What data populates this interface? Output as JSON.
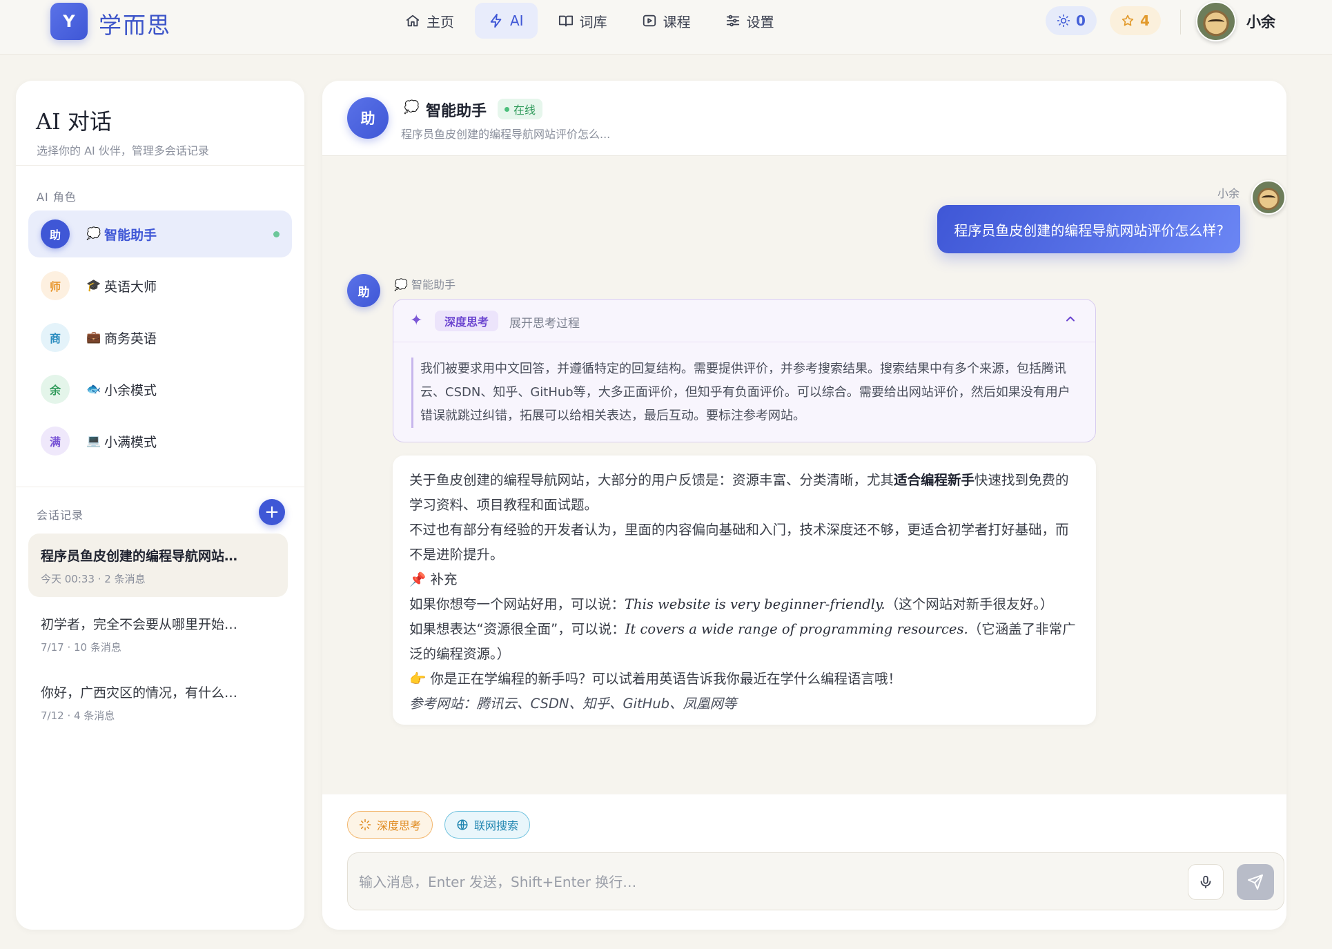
{
  "brand": {
    "logo_letter": "Y",
    "name": "学而思"
  },
  "nav": [
    {
      "label": "主页",
      "icon": "home-icon",
      "active": false
    },
    {
      "label": "AI",
      "icon": "bolt-icon",
      "active": true
    },
    {
      "label": "词库",
      "icon": "book-icon",
      "active": false
    },
    {
      "label": "课程",
      "icon": "play-icon",
      "active": false
    },
    {
      "label": "设置",
      "icon": "sliders-icon",
      "active": false
    }
  ],
  "stats": {
    "sun_count": "0",
    "star_count": "4"
  },
  "user": {
    "name": "小余"
  },
  "sidebar": {
    "title": "AI 对话",
    "subtitle": "选择你的 AI 伙伴，管理多会话记录",
    "roles_label": "AI 角色",
    "roles": [
      {
        "badge": "助",
        "emoji": "💭",
        "name": "智能助手",
        "active": true
      },
      {
        "badge": "师",
        "emoji": "🎓",
        "name": "英语大师",
        "active": false
      },
      {
        "badge": "商",
        "emoji": "💼",
        "name": "商务英语",
        "active": false
      },
      {
        "badge": "余",
        "emoji": "🐟",
        "name": "小余模式",
        "active": false
      },
      {
        "badge": "满",
        "emoji": "💻",
        "name": "小满模式",
        "active": false
      }
    ],
    "sessions_label": "会话记录",
    "add_label": "+",
    "sessions": [
      {
        "title": "程序员鱼皮创建的编程导航网站…",
        "meta": "今天 00:33 · 2 条消息",
        "active": true
      },
      {
        "title": "初学者，完全不会要从哪里开始…",
        "meta": "7/17 · 10 条消息",
        "active": false
      },
      {
        "title": "你好，广西灾区的情况，有什么…",
        "meta": "7/12 · 4 条消息",
        "active": false
      }
    ]
  },
  "chat": {
    "header": {
      "avatar": "助",
      "emoji": "💭",
      "title": "智能助手",
      "status": "在线",
      "subtitle": "程序员鱼皮创建的编程导航网站评价怎么..."
    },
    "user_message": {
      "sender": "小余",
      "text": "程序员鱼皮创建的编程导航网站评价怎么样?"
    },
    "ai_message": {
      "avatar": "助",
      "sender": "💭 智能助手",
      "thinking": {
        "tag": "深度思考",
        "toggle": "展开思考过程",
        "content": "我们被要求用中文回答，并遵循特定的回复结构。需要提供评价，并参考搜索结果。搜索结果中有多个来源，包括腾讯云、CSDN、知乎、GitHub等，大多正面评价，但知乎有负面评价。可以综合。需要给出网站评价，然后如果没有用户错误就跳过纠错，拓展可以给相关表达，最后互动。要标注参考网站。"
      },
      "answer": {
        "p1_a": "关于鱼皮创建的编程导航网站，大部分的用户反馈是：资源丰富、分类清晰，尤其",
        "p1_bold": "适合编程新手",
        "p1_b": "快速找到免费的学习资料、项目教程和面试题。",
        "p2": "不过也有部分有经验的开发者认为，里面的内容偏向基础和入门，技术深度还不够，更适合初学者打好基础，而不是进阶提升。",
        "p3": "📌 补充",
        "p4_a": "如果你想夸一个网站好用，可以说：",
        "p4_en": "This website is very beginner-friendly.",
        "p4_b": "（这个网站对新手很友好。）",
        "p5_a": "如果想表达“资源很全面”，可以说：",
        "p5_en": "It covers a wide range of programming resources.",
        "p5_b": "（它涵盖了非常广泛的编程资源。）",
        "p6": "👉 你是正在学编程的新手吗？可以试着用英语告诉我你最近在学什么编程语言哦！",
        "p7": "参考网站：腾讯云、CSDN、知乎、GitHub、凤凰网等"
      }
    },
    "options": {
      "deep_think": "深度思考",
      "web_search": "联网搜索"
    },
    "input": {
      "value": "",
      "placeholder": "输入消息，Enter 发送，Shift+Enter 换行…"
    }
  },
  "colors": {
    "accent": "#3f57d6",
    "online": "#4cbf7c",
    "think": "#7b57d6"
  }
}
